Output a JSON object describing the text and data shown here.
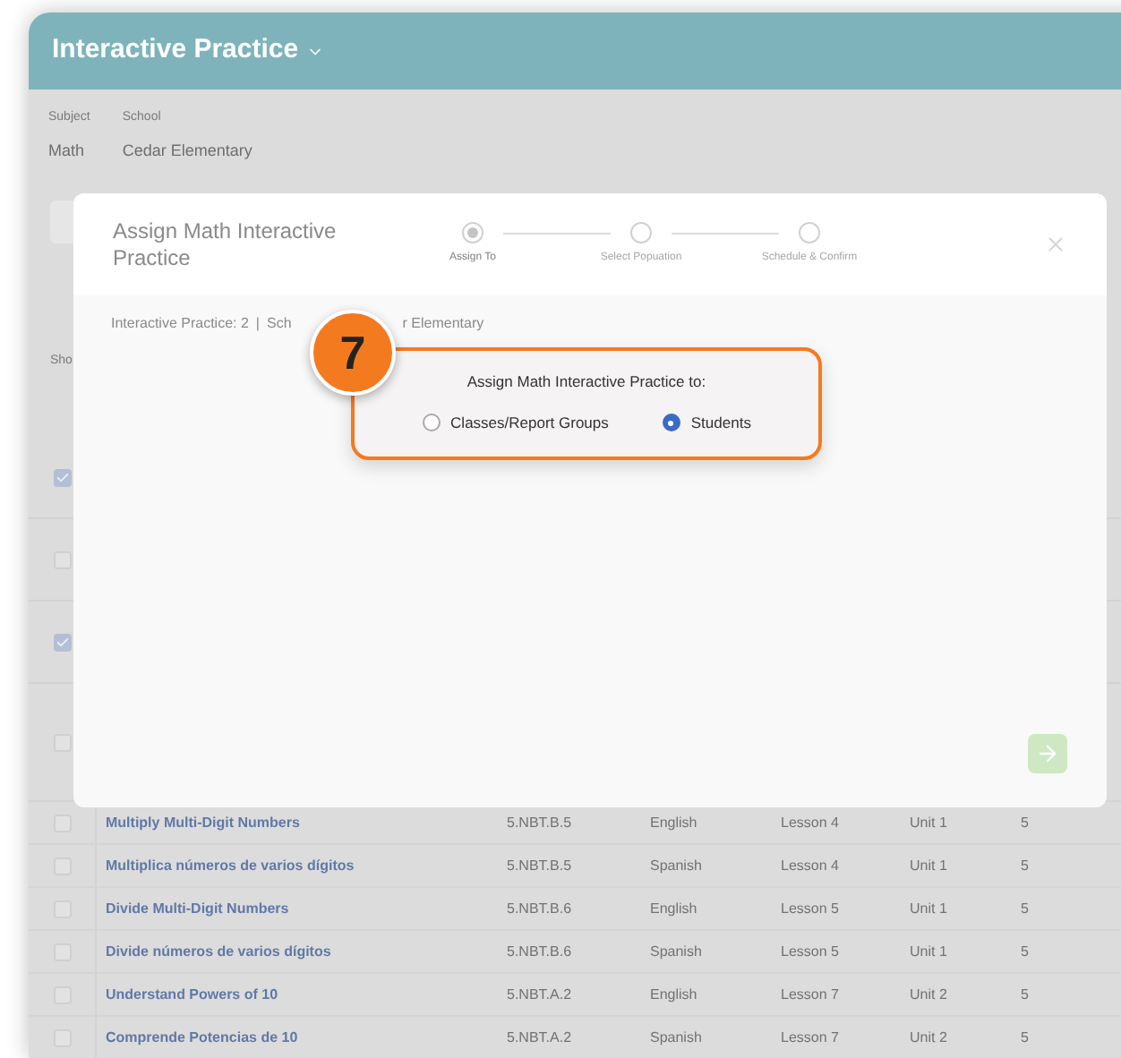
{
  "app_header": {
    "title": "Interactive Practice"
  },
  "filters": [
    {
      "label": "Subject",
      "value": "Math"
    },
    {
      "label": "School",
      "value": "Cedar Elementary"
    }
  ],
  "toolbar": {
    "partial_label": "Sho"
  },
  "hidden_rows": [
    {
      "checked": true
    },
    {
      "checked": false
    },
    {
      "checked": true
    },
    {
      "checked": false
    }
  ],
  "rows": [
    {
      "checked": false,
      "title": "Multiply Multi-Digit Numbers",
      "standard": "5.NBT.B.5",
      "language": "English",
      "lesson": "Lesson 4",
      "unit": "Unit 1",
      "grade": "5"
    },
    {
      "checked": false,
      "title": "Multiplica números de varios dígitos",
      "standard": "5.NBT.B.5",
      "language": "Spanish",
      "lesson": "Lesson 4",
      "unit": "Unit 1",
      "grade": "5"
    },
    {
      "checked": false,
      "title": "Divide Multi-Digit Numbers",
      "standard": "5.NBT.B.6",
      "language": "English",
      "lesson": "Lesson 5",
      "unit": "Unit 1",
      "grade": "5"
    },
    {
      "checked": false,
      "title": "Divide números de varios dígitos",
      "standard": "5.NBT.B.6",
      "language": "Spanish",
      "lesson": "Lesson 5",
      "unit": "Unit 1",
      "grade": "5"
    },
    {
      "checked": false,
      "title": "Understand Powers of 10",
      "standard": "5.NBT.A.2",
      "language": "English",
      "lesson": "Lesson 7",
      "unit": "Unit 2",
      "grade": "5"
    },
    {
      "checked": false,
      "title": "Comprende Potencias de 10",
      "standard": "5.NBT.A.2",
      "language": "Spanish",
      "lesson": "Lesson 7",
      "unit": "Unit 2",
      "grade": "5"
    }
  ],
  "modal": {
    "title": "Assign Math Interactive Practice",
    "steps": [
      {
        "label": "Assign To",
        "selected": true
      },
      {
        "label": "Select Popuation",
        "selected": false
      },
      {
        "label": "Schedule & Confirm",
        "selected": false
      }
    ],
    "breadcrumb": {
      "count": "Interactive Practice: 2",
      "separator": "|",
      "school_start": "Sch",
      "school_end": "r Elementary"
    },
    "callout": {
      "badge": "7",
      "prompt": "Assign Math Interactive Practice to:",
      "options": [
        {
          "label": "Classes/Report Groups",
          "selected": false
        },
        {
          "label": "Students",
          "selected": true
        }
      ]
    }
  }
}
